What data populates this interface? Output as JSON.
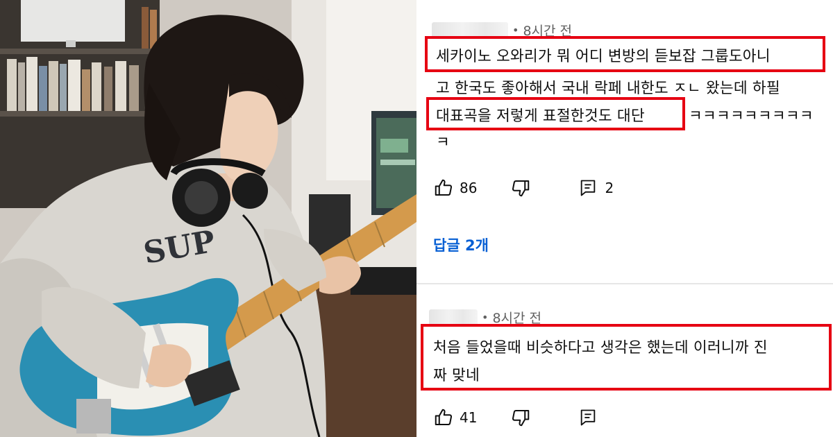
{
  "comments": [
    {
      "time_prefix": "•",
      "time": "8시간 전",
      "lines": [
        "세카이노 오와리가 뭐 어디 변방의 듣보잡 그룹도아니",
        "고 한국도 좋아해서 국내 락페 내한도 ㅈㄴ 왔는데 하필",
        "대표곡을 저렇게  표절한것도 대단",
        "ㅋㅋㅋㅋㅋㅋㅋㅋㅋ",
        "ㅋ"
      ],
      "likes": "86",
      "reply_count": "2",
      "view_replies": "답글 2개"
    },
    {
      "time_prefix": "•",
      "time": "8시간 전",
      "lines": [
        "처음 들었을때 비슷하다고 생각은 했는데 이러니까 진",
        "짜 맞네"
      ],
      "likes": "41"
    }
  ],
  "colors": {
    "highlight_box": "#e60012",
    "link": "#065fd4",
    "guitar_body": "#2a8fb3"
  },
  "icons": [
    "like-icon",
    "dislike-icon",
    "reply-icon"
  ]
}
